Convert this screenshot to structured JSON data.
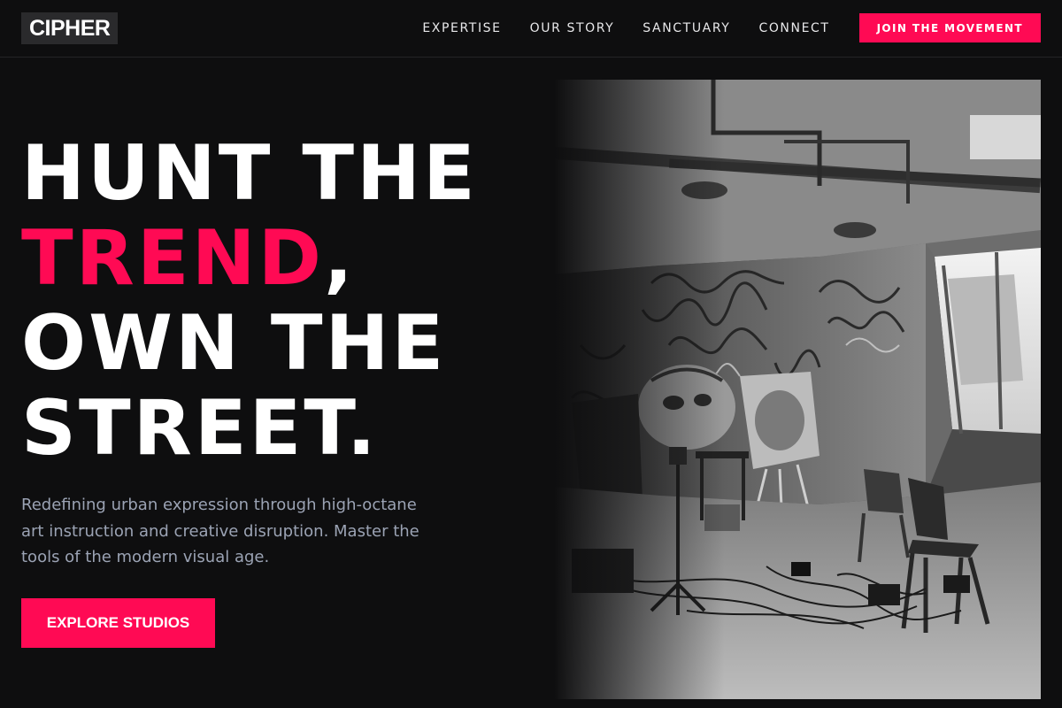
{
  "brand": {
    "logo": "CIPHER"
  },
  "nav": {
    "items": [
      {
        "label": "EXPERTISE"
      },
      {
        "label": "OUR STORY"
      },
      {
        "label": "SANCTUARY"
      },
      {
        "label": "CONNECT"
      }
    ],
    "cta_label": "JOIN THE MOVEMENT"
  },
  "hero": {
    "headline": {
      "line1": "HUNT THE",
      "line2_accent": "TREND",
      "line2_rest": ",",
      "line3": "OWN THE",
      "line4": "STREET."
    },
    "subtitle": "Redefining urban expression through high-octane art instruction and creative disruption. Master the tools of the modern visual age.",
    "cta_label": "EXPLORE STUDIOS"
  },
  "colors": {
    "background": "#0e0e0f",
    "accent": "#ff0a54",
    "text": "#ffffff",
    "muted": "#9ba3b4"
  }
}
